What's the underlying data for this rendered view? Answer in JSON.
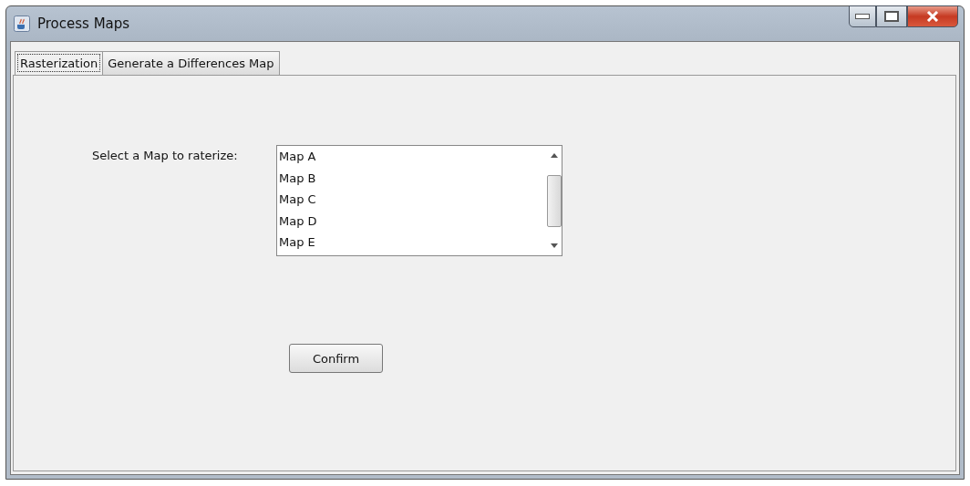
{
  "window": {
    "title": "Process Maps"
  },
  "tabs": [
    {
      "label": "Rasterization",
      "selected": true
    },
    {
      "label": "Generate a Differences Map",
      "selected": false
    }
  ],
  "map_select": {
    "label": "Select a Map to raterize:",
    "items": [
      "Map A",
      "Map B",
      "Map C",
      "Map D",
      "Map E"
    ]
  },
  "buttons": [
    "Confirm"
  ]
}
